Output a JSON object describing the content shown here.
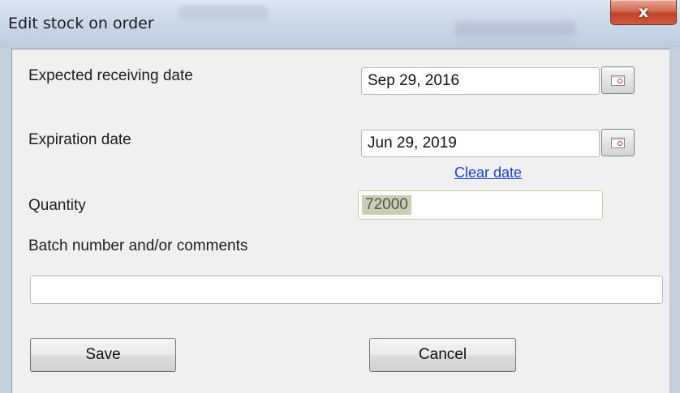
{
  "window": {
    "title": "Edit stock on order",
    "close_glyph": "x"
  },
  "form": {
    "expected_receiving_date": {
      "label": "Expected receiving date",
      "value": "Sep 29, 2016"
    },
    "expiration_date": {
      "label": "Expiration date",
      "value": "Jun 29, 2019",
      "clear_link": "Clear date"
    },
    "quantity": {
      "label": "Quantity",
      "value": "72000"
    },
    "batch": {
      "label": "Batch number and/or comments",
      "value": ""
    }
  },
  "buttons": {
    "save": "Save",
    "cancel": "Cancel"
  },
  "icons": {
    "calendar": "calendar-icon",
    "close": "close-icon"
  },
  "colors": {
    "link": "#1a3fd8",
    "close_button": "#c0432a",
    "selection": "#c9cfb3"
  }
}
